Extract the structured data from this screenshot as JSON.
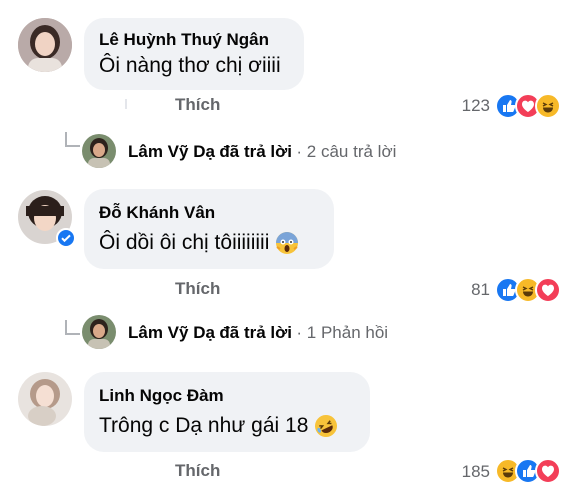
{
  "comments": [
    {
      "author": "Lê Huỳnh Thuý Ngân",
      "text": "Ôi nàng thơ chị ơiiii",
      "like_label": "Thích",
      "reaction_count": "123",
      "reactions": [
        "like",
        "love",
        "haha"
      ]
    },
    {
      "author": "Đỗ Khánh Vân",
      "text": "Ôi dồi ôi chị tôiiiiiiii",
      "like_label": "Thích",
      "reaction_count": "81",
      "reactions": [
        "like",
        "haha",
        "love"
      ],
      "verified": true
    },
    {
      "author": "Linh Ngọc Đàm",
      "text": "Trông c Dạ như gái 18",
      "like_label": "Thích",
      "reaction_count": "185",
      "reactions": [
        "haha",
        "like",
        "love"
      ]
    }
  ],
  "replies": [
    {
      "author": "Lâm Vỹ Dạ",
      "action": "đã trả lời",
      "summary": "· 2 câu trả lời"
    },
    {
      "author": "Lâm Vỹ Dạ",
      "action": "đã trả lời",
      "summary": "· 1 Phản hồi"
    }
  ],
  "colors": {
    "bubble": "#f0f2f5",
    "like_blue": "#1877f2",
    "love_red": "#f33e58",
    "haha_yellow": "#f7b928",
    "secondary_text": "#65676b"
  }
}
